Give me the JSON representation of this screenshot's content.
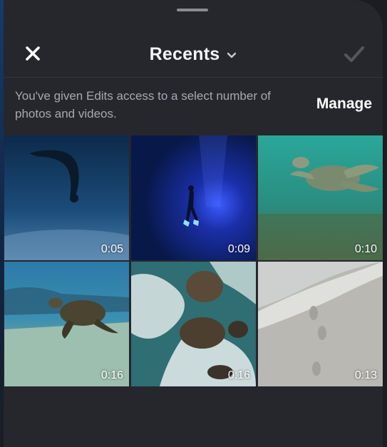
{
  "header": {
    "title": "Recents",
    "close_icon": "close-icon",
    "dropdown_icon": "chevron-down-icon",
    "confirm_icon": "checkmark-icon"
  },
  "notice": {
    "text": "You've given Edits access to a select number of photos and videos.",
    "manage_label": "Manage"
  },
  "media": [
    {
      "subject": "diver underwater",
      "duration": "0:05"
    },
    {
      "subject": "freediver descending in blue water",
      "duration": "0:09"
    },
    {
      "subject": "sea turtle swimming",
      "duration": "0:10"
    },
    {
      "subject": "sea turtle on sand",
      "duration": "0:16"
    },
    {
      "subject": "waves over rocks aerial",
      "duration": "0:16"
    },
    {
      "subject": "footprints on beach",
      "duration": "0:13"
    }
  ],
  "colors": {
    "sheet": "#25272d",
    "background": "#1b1d22",
    "text_primary": "#f2f3f5",
    "text_secondary": "#a7a9ae"
  }
}
